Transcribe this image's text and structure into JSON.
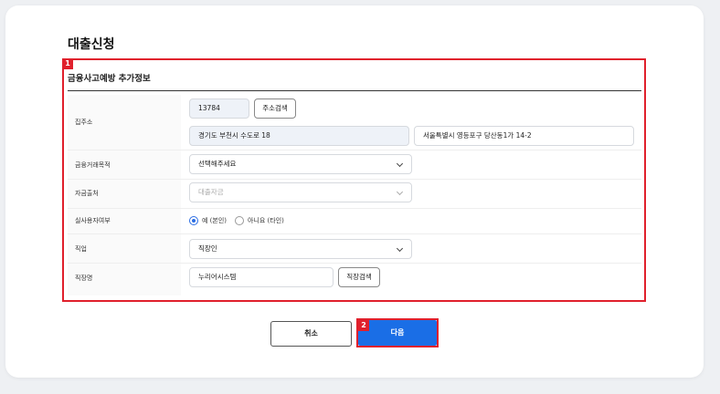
{
  "page_title": "대출신청",
  "section": {
    "badge": "1",
    "title": "금융사고예방 추가정보"
  },
  "address": {
    "label": "집주소",
    "postcode": "13784",
    "search_button": "주소검색",
    "road_address": "경기도 부천시 수도로 18",
    "detail_address": "서울특별시 영등포구 당산동1가 14-2"
  },
  "purpose": {
    "label": "금융거래목적",
    "value": "선택해주세요"
  },
  "fund_source": {
    "label": "자금출처",
    "value": "대출자금"
  },
  "beneficial_owner": {
    "label": "실사용자여부",
    "options": [
      "예 (본인)",
      "아니요 (타인)"
    ],
    "selected": "예 (본인)"
  },
  "job": {
    "label": "직업",
    "value": "직장인"
  },
  "workplace": {
    "label": "직장명",
    "value": "누리어시스템",
    "search_button": "직장검색"
  },
  "actions": {
    "cancel": "취소",
    "next": "다음",
    "next_badge": "2"
  },
  "colors": {
    "primary": "#1a6ee6",
    "highlight": "#e0202c"
  }
}
